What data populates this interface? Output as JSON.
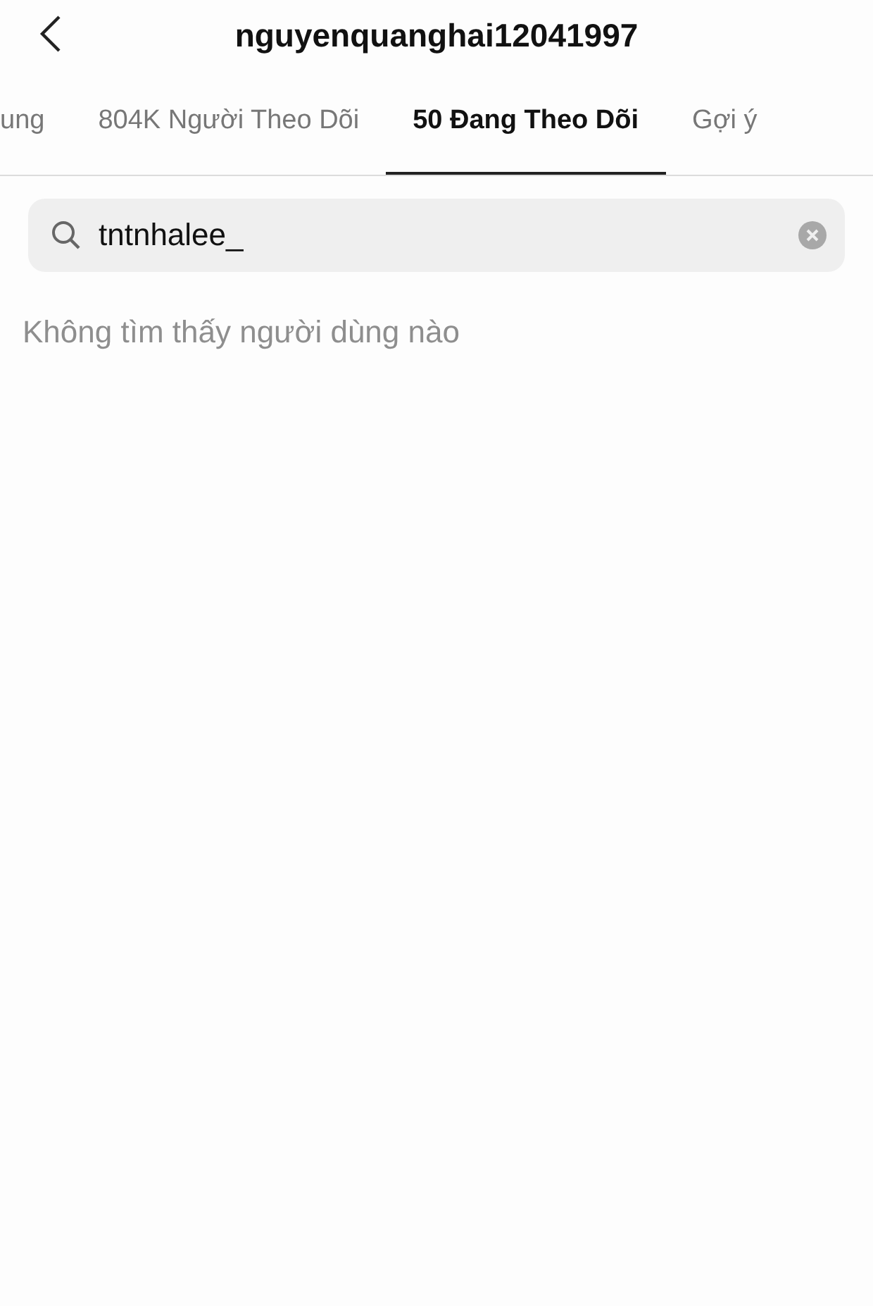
{
  "header": {
    "title": "nguyenquanghai12041997"
  },
  "tabs": [
    {
      "label": "ung",
      "selected": false
    },
    {
      "label": "804K Người Theo Dõi",
      "selected": false
    },
    {
      "label": "50 Đang Theo Dõi",
      "selected": true
    },
    {
      "label": "Gợi ý",
      "selected": false
    }
  ],
  "search": {
    "value": "tntnhalee_"
  },
  "empty_message": "Không tìm thấy người dùng nào"
}
